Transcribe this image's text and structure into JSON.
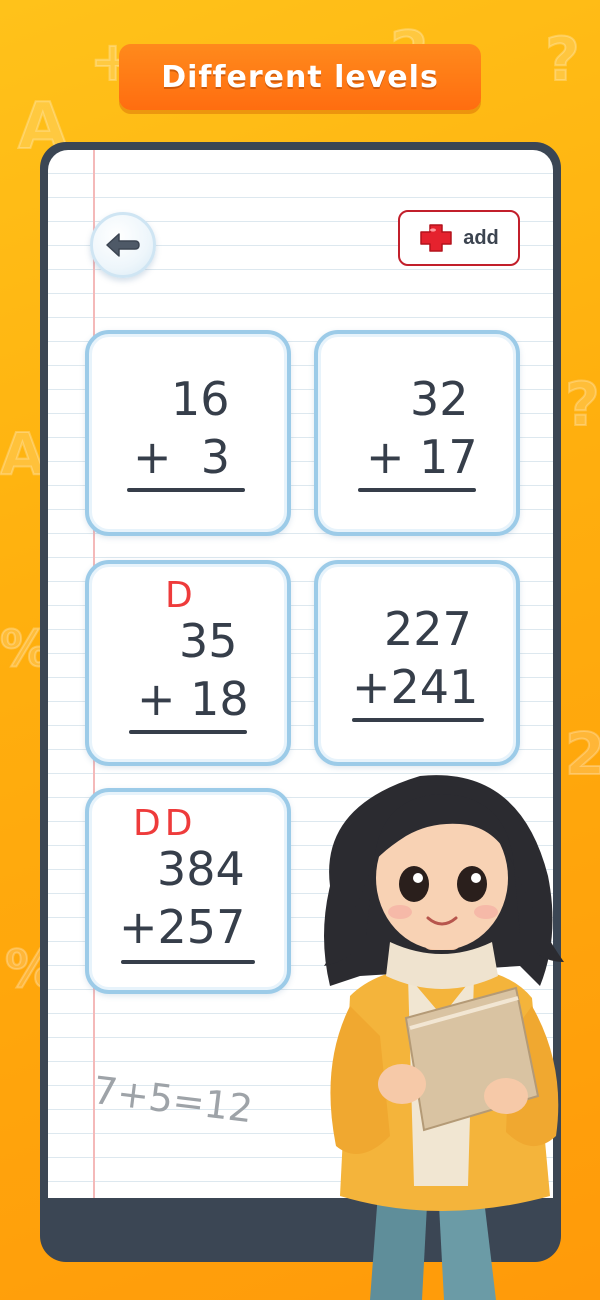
{
  "banner": {
    "title": "Different levels"
  },
  "header": {
    "back_icon": "back-arrow-icon",
    "add_icon": "red-cross-plus-icon",
    "add_label": "add"
  },
  "cards": [
    {
      "top": "16",
      "bottom": "+  3",
      "carry": ""
    },
    {
      "top": "32",
      "bottom": "+ 17",
      "carry": ""
    },
    {
      "top": "35",
      "bottom": "+ 18",
      "carry": "D"
    },
    {
      "top": "227",
      "bottom": "+241",
      "carry": ""
    },
    {
      "top": "384",
      "bottom": "+257",
      "carry": "DD"
    }
  ],
  "scribble": "7+5=12",
  "colors": {
    "background": "#ffb00e",
    "banner": "#ff7a14",
    "card_border": "#9ccbe8",
    "carry": "#ee3b3b",
    "add_border": "#c21f2b"
  }
}
